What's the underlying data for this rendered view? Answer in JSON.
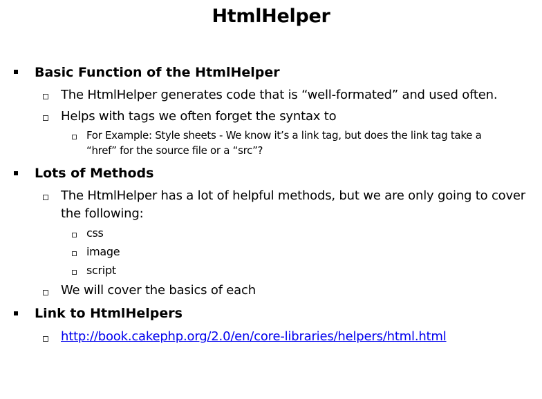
{
  "title": "HtmlHelper",
  "sections": [
    {
      "heading": "Basic Function of the HtmlHelper",
      "items": [
        {
          "text": "The HtmlHelper generates code that is “well-formated” and used often."
        },
        {
          "text": "Helps with tags we often forget the syntax to",
          "subitems": [
            {
              "line1": "For Example: Style sheets  - We know it’s a link tag, but does the link tag take a",
              "line2": "“href” for the source file or a “src”?"
            }
          ]
        }
      ]
    },
    {
      "heading": "Lots of Methods",
      "items": [
        {
          "line1": "The HtmlHelper has a lot of helpful methods, but we are only going to cover",
          "line2": "the following:",
          "subitems": [
            "css",
            "image",
            "script"
          ]
        },
        {
          "text": "We will cover the basics of each"
        }
      ]
    },
    {
      "heading": "Link to HtmlHelpers",
      "items": [
        {
          "link": "http://book.cakephp.org/2.0/en/core-libraries/helpers/html.html"
        }
      ]
    }
  ]
}
